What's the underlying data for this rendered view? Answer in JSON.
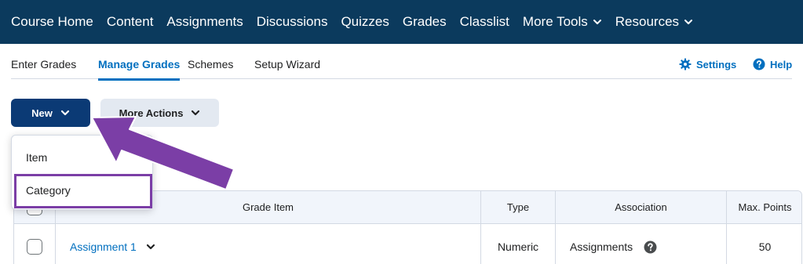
{
  "nav": {
    "items": [
      {
        "label": "Course Home",
        "has_menu": false
      },
      {
        "label": "Content",
        "has_menu": false
      },
      {
        "label": "Assignments",
        "has_menu": false
      },
      {
        "label": "Discussions",
        "has_menu": false
      },
      {
        "label": "Quizzes",
        "has_menu": false
      },
      {
        "label": "Grades",
        "has_menu": false
      },
      {
        "label": "Classlist",
        "has_menu": false
      },
      {
        "label": "More Tools",
        "has_menu": true
      },
      {
        "label": "Resources",
        "has_menu": true
      }
    ]
  },
  "subnav": {
    "tabs": [
      {
        "label": "Enter Grades",
        "active": false
      },
      {
        "label": "Manage Grades",
        "active": true
      },
      {
        "label": "Schemes",
        "active": false
      },
      {
        "label": "Setup Wizard",
        "active": false
      }
    ],
    "settings_label": "Settings",
    "help_label": "Help",
    "settings_icon": "gear-icon",
    "help_icon": "question-circle-icon"
  },
  "actions": {
    "new_label": "New",
    "more_actions_label": "More Actions"
  },
  "new_menu": {
    "items": [
      "Item",
      "Category"
    ],
    "highlighted": "Category"
  },
  "table": {
    "headers": [
      "Grade Item",
      "Type",
      "Association",
      "Max. Points"
    ],
    "rows": [
      {
        "name": "Assignment 1",
        "type": "Numeric",
        "association": "Assignments",
        "max_points": "50"
      }
    ]
  },
  "colors": {
    "nav_bg": "#0b3a5d",
    "accent": "#006fbf",
    "primary_button": "#0b3a75",
    "annotation": "#7b3ea6"
  }
}
